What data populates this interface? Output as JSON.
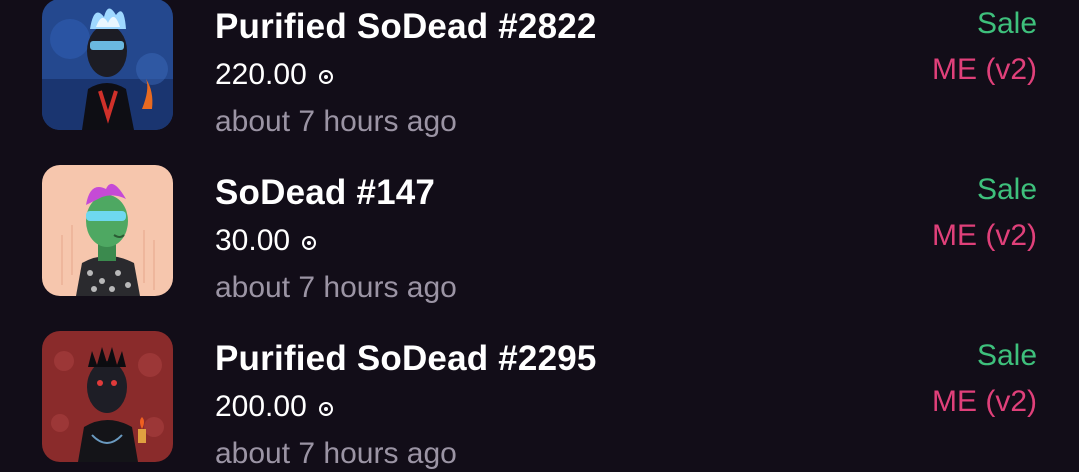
{
  "activity": [
    {
      "name": "Purified SoDead #2822",
      "price": "220.00",
      "currency_icon": "sol-icon",
      "time": "about 7 hours ago",
      "type": "Sale",
      "marketplace": "ME (v2)",
      "thumb_bg": "#2c5aa8"
    },
    {
      "name": "SoDead #147",
      "price": "30.00",
      "currency_icon": "sol-icon",
      "time": "about 7 hours ago",
      "type": "Sale",
      "marketplace": "ME (v2)",
      "thumb_bg": "#f6c2a8"
    },
    {
      "name": "Purified SoDead #2295",
      "price": "200.00",
      "currency_icon": "sol-icon",
      "time": "about 7 hours ago",
      "type": "Sale",
      "marketplace": "ME (v2)",
      "thumb_bg": "#8e2a2a"
    }
  ],
  "colors": {
    "background": "#120d18",
    "sale": "#3ec07c",
    "marketplace": "#e0407a",
    "muted": "#9b94a4"
  }
}
